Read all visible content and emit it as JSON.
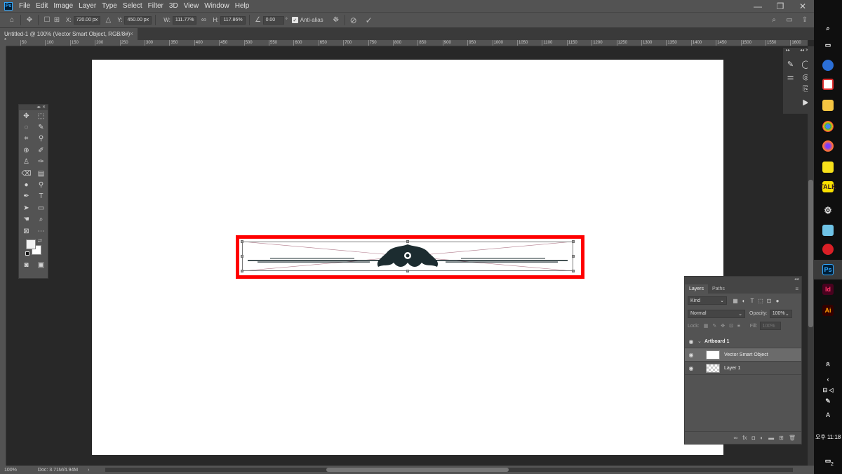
{
  "app": {
    "logo": "Ps"
  },
  "menu": [
    "File",
    "Edit",
    "Image",
    "Layer",
    "Type",
    "Select",
    "Filter",
    "3D",
    "View",
    "Window",
    "Help"
  ],
  "window_controls": {
    "minimize": "—",
    "restore": "❐",
    "close": "✕"
  },
  "options": {
    "x_label": "X:",
    "x_value": "720.00 px",
    "y_label": "Y:",
    "y_value": "450.00 px",
    "w_label": "W:",
    "w_value": "111.77%",
    "h_label": "H:",
    "h_value": "117.86%",
    "angle_value": "0.00",
    "angle_unit": "°",
    "antialias_label": "Anti-alias",
    "antialias_checked": true
  },
  "document": {
    "tab_title": "Untitled-1 @ 100% (Vector Smart Object, RGB/8#) *"
  },
  "ruler_ticks": [
    "50",
    "100",
    "150",
    "200",
    "250",
    "300",
    "350",
    "400",
    "450",
    "500",
    "550",
    "600",
    "650",
    "700",
    "750",
    "800",
    "850",
    "900",
    "950",
    "1000",
    "1050",
    "1100",
    "1150",
    "1200",
    "1250",
    "1300",
    "1350",
    "1400",
    "1450",
    "1500",
    "1550",
    "1600"
  ],
  "layers_panel": {
    "tabs": [
      "Layers",
      "Paths"
    ],
    "filter_placeholder": "Kind",
    "blend_mode": "Normal",
    "opacity_label": "Opacity:",
    "opacity_value": "100%",
    "lock_label": "Lock:",
    "fill_label": "Fill:",
    "fill_value": "100%",
    "layers": [
      {
        "name": "Artboard 1",
        "type": "group"
      },
      {
        "name": "Vector Smart Object",
        "type": "smart-object",
        "selected": true
      },
      {
        "name": "Layer 1",
        "type": "raster"
      }
    ]
  },
  "status": {
    "zoom": "100%",
    "doc_size": "Doc: 3.71M/4.94M"
  },
  "taskbar": {
    "clock": "오후 11:18",
    "notification_count": "2",
    "language": "A"
  },
  "colors": {
    "ui_bg": "#535353",
    "workspace": "#282828",
    "highlight": "#ff0000",
    "ps_accent": "#31a8ff"
  }
}
